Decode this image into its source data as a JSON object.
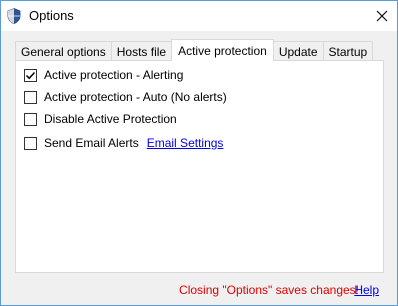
{
  "window": {
    "title": "Options",
    "icons": {
      "app": "shield-icon",
      "close": "close-icon"
    }
  },
  "tabs": [
    {
      "label": "General options",
      "selected": false
    },
    {
      "label": "Hosts file",
      "selected": false
    },
    {
      "label": "Active protection",
      "selected": true
    },
    {
      "label": "Update",
      "selected": false
    },
    {
      "label": "Startup",
      "selected": false
    }
  ],
  "options": [
    {
      "label": "Active protection - Alerting",
      "checked": true
    },
    {
      "label": "Active protection - Auto (No alerts)",
      "checked": false
    },
    {
      "label": "Disable Active Protection",
      "checked": false
    },
    {
      "label": "Send Email Alerts",
      "checked": false,
      "link": "Email Settings"
    }
  ],
  "footer": {
    "note": "Closing \"Options\" saves changes!",
    "help": "Help",
    "note_color": "#e00000",
    "link_color": "#0000ee"
  }
}
